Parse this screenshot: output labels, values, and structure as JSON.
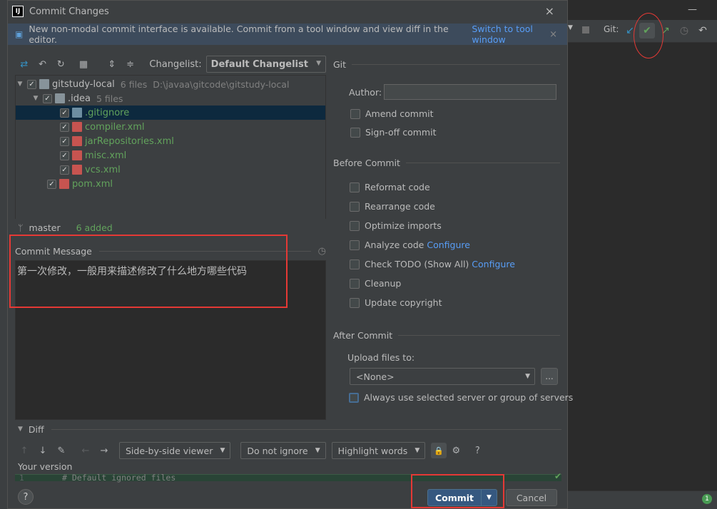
{
  "dialog": {
    "title": "Commit Changes",
    "app_logo": "IJ",
    "close": "×"
  },
  "banner": {
    "text": "New non-modal commit interface is available. Commit from a tool window and view diff in the editor.",
    "link": "Switch to tool window",
    "close": "×"
  },
  "toolbar": {
    "changelist_label": "Changelist:",
    "changelist_value": "Default Changelist"
  },
  "tree": {
    "root": {
      "name": "gitstudy-local",
      "count": "6 files",
      "path": "D:\\javaa\\gitcode\\gitstudy-local"
    },
    "folder": {
      "name": ".idea",
      "count": "5 files"
    },
    "files": [
      ".gitignore",
      "compiler.xml",
      "jarRepositories.xml",
      "misc.xml",
      "vcs.xml"
    ],
    "root_file": "pom.xml"
  },
  "status": {
    "branch": "master",
    "added": "6 added"
  },
  "commit_message": {
    "label": "Commit Message",
    "text": "第一次修改，一般用来描述修改了什么地方哪些代码"
  },
  "git": {
    "section": "Git",
    "author_label": "Author:",
    "author_value": "",
    "amend": "Amend commit",
    "signoff": "Sign-off commit"
  },
  "before_commit": {
    "section": "Before Commit",
    "reformat": "Reformat code",
    "rearrange": "Rearrange code",
    "optimize": "Optimize imports",
    "analyze": "Analyze code",
    "analyze_cfg": "Configure",
    "todo": "Check TODO (Show All)",
    "todo_cfg": "Configure",
    "cleanup": "Cleanup",
    "copyright": "Update copyright"
  },
  "after_commit": {
    "section": "After Commit",
    "upload_label": "Upload files to:",
    "upload_value": "<None>",
    "always_use": "Always use selected server or group of servers"
  },
  "diff": {
    "section": "Diff",
    "viewer": "Side-by-side viewer",
    "ignore": "Do not ignore",
    "highlight": "Highlight words",
    "your_version": "Your version",
    "line_no": "1",
    "line_text": "# Default ignored files"
  },
  "buttons": {
    "commit": "Commit",
    "cancel": "Cancel",
    "help": "?"
  },
  "ide": {
    "git_label": "Git:",
    "badge": "1"
  },
  "colors": {
    "accent": "#365880",
    "added": "#62a35c",
    "link": "#589df6",
    "highlight_box": "#e53935"
  }
}
